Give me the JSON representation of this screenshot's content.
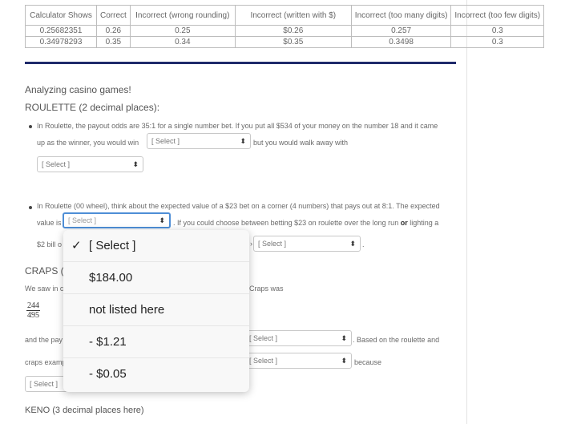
{
  "table": {
    "headers": [
      "Calculator Shows",
      "Correct",
      "Incorrect (wrong rounding)",
      "Incorrect (written with $)",
      "Incorrect (too many digits)",
      "Incorrect (too few digits)"
    ],
    "rows": [
      [
        "0.25682351",
        "0.26",
        "0.25",
        "$0.26",
        "0.257",
        "0.3"
      ],
      [
        "0.34978293",
        "0.35",
        "0.34",
        "$0.35",
        "0.3498",
        "0.3"
      ]
    ]
  },
  "section": {
    "intro": "Analyzing casino games!",
    "roulette_heading": "ROULETTE (2 decimal places):",
    "q1_line1": "In Roulette, the payout odds are 35:1 for a single number bet. If you put all $534 of your money on the number 18 and it came",
    "q1_line2_pre": "up as the winner, you would win",
    "q1_line2_post": "but you would walk away with",
    "q2_line1": "In Roulette (00 wheel), think about the expected value of a $23 bet on a corner (4 numbers) that pays out at 8:1. The expected",
    "q2_line2_pre": "value is",
    "q2_line2_post": ". If you could choose between betting $23 on roulette over the long run",
    "q2_or": "or",
    "q2_line2_end": "lighting a",
    "q2_line3_pre": "$2 bill o",
    "craps_heading": "CRAPS (2",
    "craps_line1_pre": "We saw in c",
    "craps_line1_post": "Craps was",
    "fraction_num": "244",
    "fraction_den": "495",
    "craps_line2_pre": "and the pay",
    "craps_line2_post": ". Based on the roulette and",
    "craps_line3_pre": "craps examp",
    "craps_line3_post": "because",
    "keno_heading": "KENO (3 decimal places here)"
  },
  "selects": {
    "placeholder": "[ Select ]",
    "arrow": "⬍"
  },
  "dropdown": {
    "check": "✓",
    "options": [
      "[ Select ]",
      "$184.00",
      "not listed here",
      "- $1.21",
      "- $0.05"
    ],
    "selected_index": 0
  },
  "colors": {
    "rule": "#1f2a6b",
    "focus": "#4e8ed6"
  }
}
